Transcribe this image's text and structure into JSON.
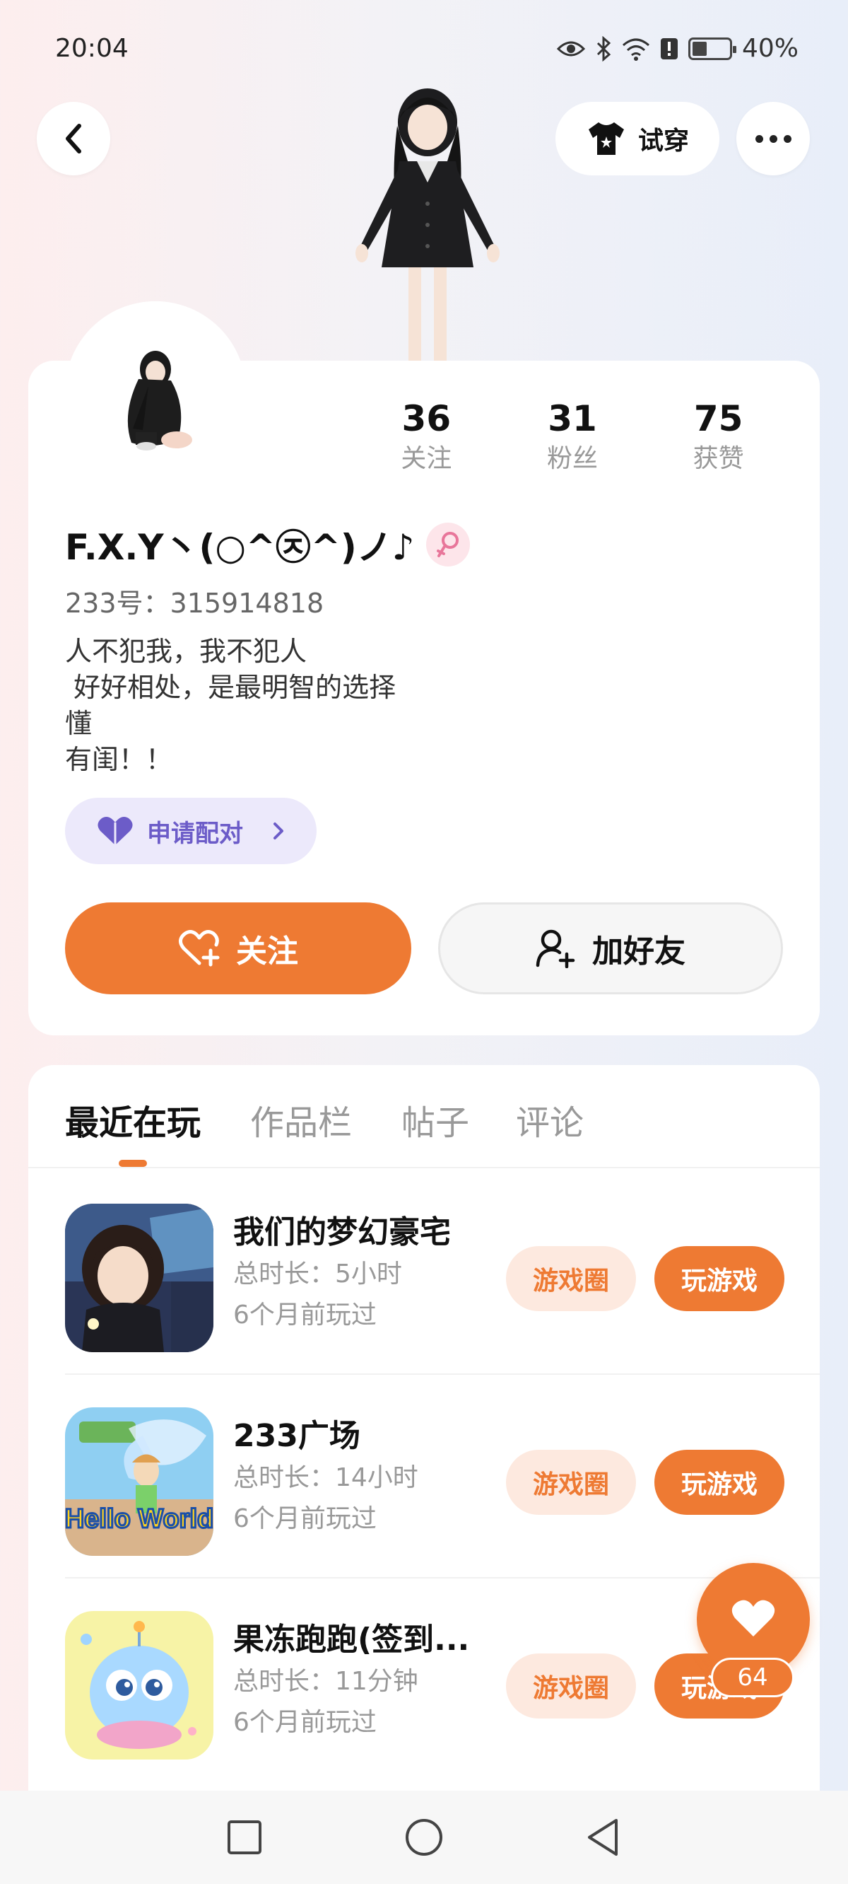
{
  "status_bar": {
    "time": "20:04",
    "battery_percent": "40%",
    "icons": [
      "eye-icon",
      "bluetooth-icon",
      "wifi-icon",
      "alert-icon",
      "battery-icon"
    ]
  },
  "top_bar": {
    "tryon_label": "试穿"
  },
  "profile": {
    "nickname": "F.X.Y丶(○^㉨^)ノ♪",
    "user_id": "233号：315914818",
    "bio": "人不犯我，我不犯人\n 好好相处，是最明智的选择\n懂\n有闺！！",
    "stats": [
      {
        "num": "36",
        "label": "关注"
      },
      {
        "num": "31",
        "label": "粉丝"
      },
      {
        "num": "75",
        "label": "获赞"
      }
    ],
    "pair_label": "申请配对",
    "follow_label": "关注",
    "add_friend_label": "加好友"
  },
  "tabs": [
    "最近在玩",
    "作品栏",
    "帖子",
    "评论"
  ],
  "games": [
    {
      "name": "我们的梦幻豪宅",
      "duration": "总时长：5小时",
      "last_played": "6个月前玩过",
      "circle_label": "游戏圈",
      "play_label": "玩游戏"
    },
    {
      "name": "233广场",
      "duration": "总时长：14小时",
      "last_played": "6个月前玩过",
      "circle_label": "游戏圈",
      "play_label": "玩游戏",
      "icon_text": "Hello World"
    },
    {
      "name": "果冻跑跑(签到...",
      "duration": "总时长：11分钟",
      "last_played": "6个月前玩过",
      "circle_label": "游戏圈",
      "play_label": "玩游戏"
    }
  ],
  "floating_like": {
    "count": "64"
  },
  "colors": {
    "accent": "#ee7a33",
    "pair_purple": "#6c5cc8",
    "gender_pink": "#e8769a"
  }
}
